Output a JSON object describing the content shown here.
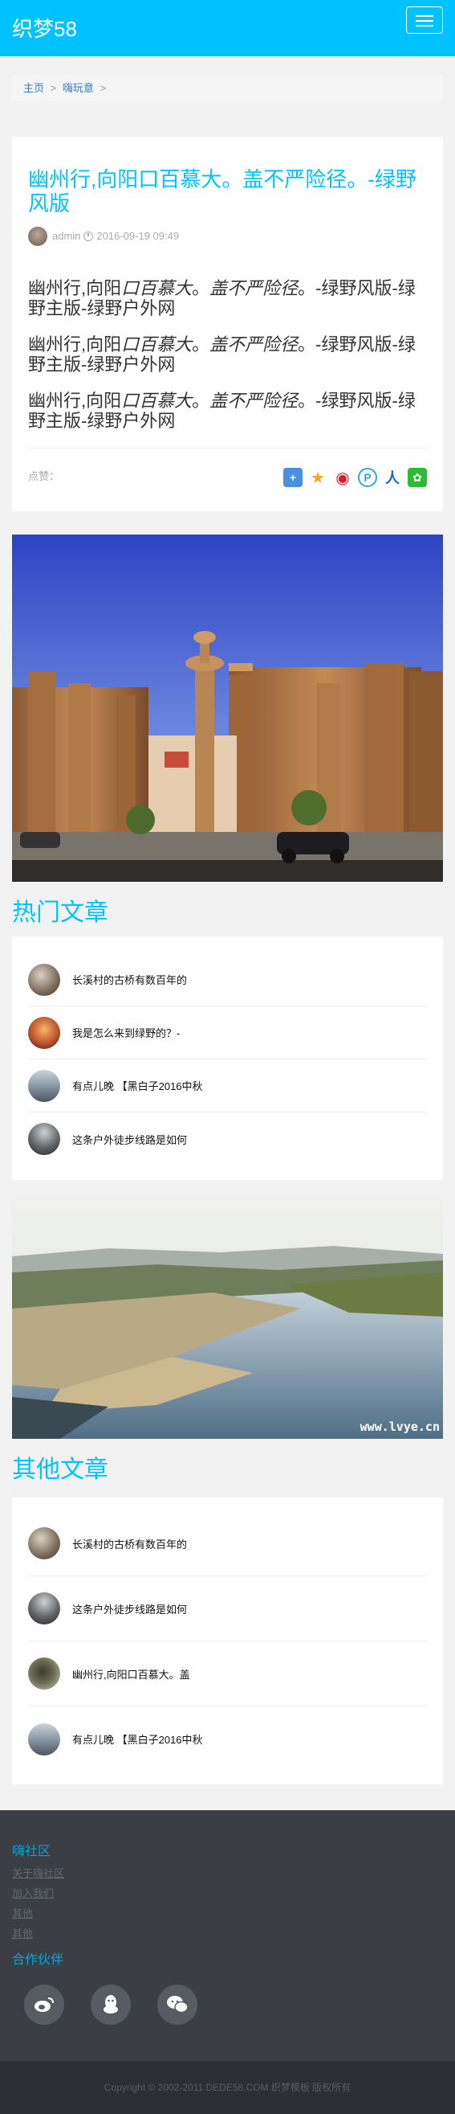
{
  "header": {
    "brand": "织梦58"
  },
  "breadcrumb": {
    "home": "主页",
    "sep": ">",
    "category": "嗨玩意",
    "trail": ">"
  },
  "article": {
    "title": "幽州行,向阳口百慕大。盖不严险径。-绿野风版",
    "author": "admin",
    "date": "2016-09-19 09:49",
    "paragraphs": [
      {
        "a": "幽州行,向阳",
        "b": "口百慕大",
        "c": "。",
        "d": "盖不严险径",
        "e": "。-绿野风版-绿野主版-绿野户外网"
      },
      {
        "a": "幽州行,向阳",
        "b": "口百慕大",
        "c": "。",
        "d": "盖不严险径",
        "e": "。-绿野风版-绿野主版-绿野户外网"
      },
      {
        "a": "幽州行,向阳",
        "b": "口百慕大",
        "c": "。",
        "d": "盖不严险径",
        "e": "。-绿野风版-绿野主版-绿野户外网"
      }
    ],
    "zan_label": "点赞：",
    "share_icons": [
      {
        "name": "share-more-icon",
        "glyph": "+",
        "color": "#4a90e2"
      },
      {
        "name": "qzone-icon",
        "glyph": "★",
        "color": "#f5a623"
      },
      {
        "name": "weibo-icon",
        "glyph": "◉",
        "color": "#e6162d"
      },
      {
        "name": "tencent-weibo-icon",
        "glyph": "P",
        "color": "#3aa3e3"
      },
      {
        "name": "renren-icon",
        "glyph": "人",
        "color": "#2266bb"
      },
      {
        "name": "wechat-icon",
        "glyph": "✿",
        "color": "#2dbb35"
      }
    ]
  },
  "hot": {
    "title": "热门文章",
    "items": [
      {
        "label": "长溪村的古桥有数百年的",
        "color": "#7a6a5a"
      },
      {
        "label": "我是怎么来到绿野的？-",
        "color": "#c0532c"
      },
      {
        "label": "有点儿晚 【黑白子2016中秋",
        "color": "#8a97a3"
      },
      {
        "label": "这条户外徒步线路是如何",
        "color": "#5f6467"
      }
    ]
  },
  "other": {
    "title": "其他文章",
    "items": [
      {
        "label": "长溪村的古桥有数百年的",
        "color": "#7a6a5a"
      },
      {
        "label": "这条户外徒步线路是如何",
        "color": "#5f6467"
      },
      {
        "label": "幽州行,向阳口百慕大。盖",
        "color": "#6b6b55"
      },
      {
        "label": "有点儿晚 【黑白子2016中秋",
        "color": "#8a97a3"
      }
    ]
  },
  "photo2_watermark": "www.lvye.cn",
  "footer": {
    "about_title": "嗨社区",
    "links": [
      "关于嗨社区",
      "加入我们",
      "其他",
      "其他"
    ],
    "partner_title": "合作伙伴",
    "copyright": "Copyright © 2002-2011 DEDE58.COM 织梦模板 版权所有"
  }
}
